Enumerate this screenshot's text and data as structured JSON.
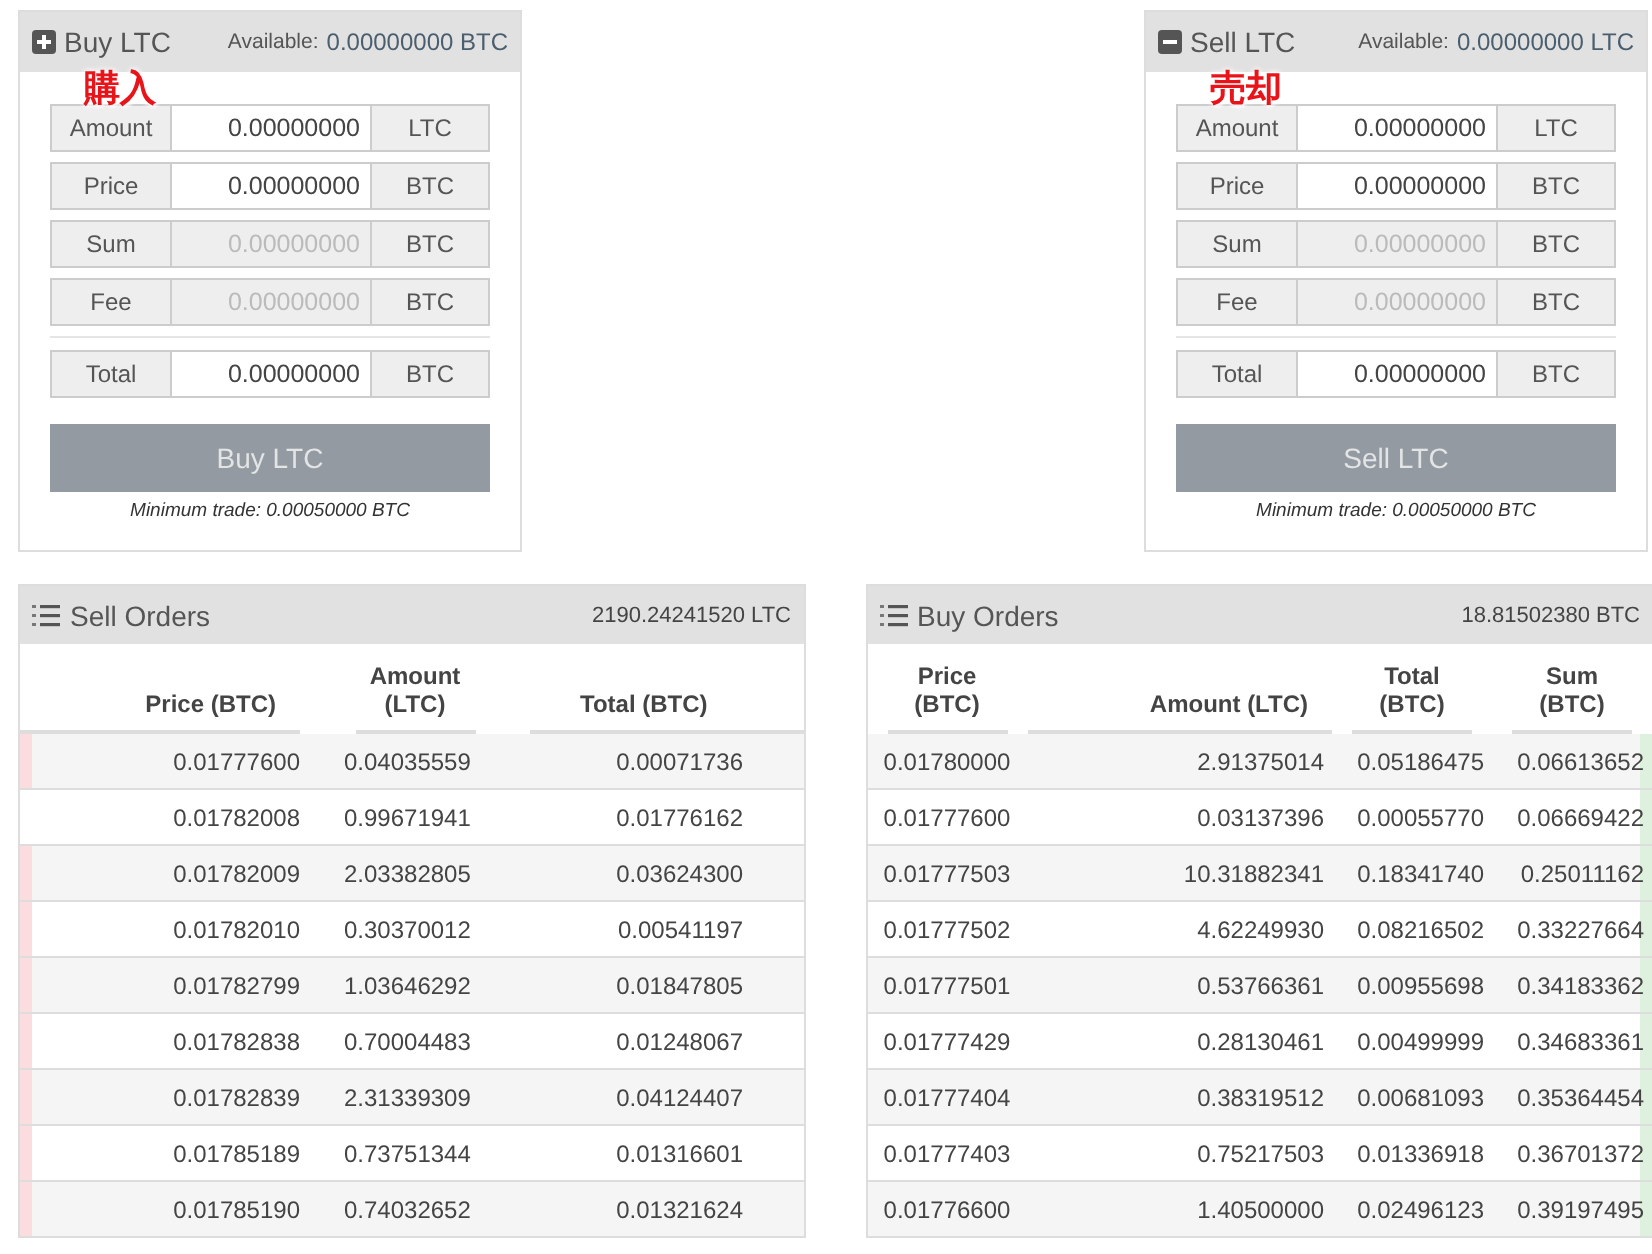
{
  "trade_panels": [
    {
      "kind": "buy",
      "title": "Buy LTC",
      "available_label": "Available:",
      "available_value": "0.00000000 BTC",
      "annotation": "購入",
      "fields": [
        {
          "label": "Amount",
          "value": "0.00000000",
          "unit": "LTC",
          "disabled": false
        },
        {
          "label": "Price",
          "value": "0.00000000",
          "unit": "BTC",
          "disabled": false
        },
        {
          "label": "Sum",
          "value": "0.00000000",
          "unit": "BTC",
          "disabled": true
        },
        {
          "label": "Fee",
          "value": "0.00000000",
          "unit": "BTC",
          "disabled": true
        }
      ],
      "total": {
        "label": "Total",
        "value": "0.00000000",
        "unit": "BTC",
        "disabled": false
      },
      "button": "Buy LTC",
      "minimum": "Minimum trade: 0.00050000 BTC"
    },
    {
      "kind": "sell",
      "title": "Sell LTC",
      "available_label": "Available:",
      "available_value": "0.00000000 LTC",
      "annotation": "売却",
      "fields": [
        {
          "label": "Amount",
          "value": "0.00000000",
          "unit": "LTC",
          "disabled": false
        },
        {
          "label": "Price",
          "value": "0.00000000",
          "unit": "BTC",
          "disabled": false
        },
        {
          "label": "Sum",
          "value": "0.00000000",
          "unit": "BTC",
          "disabled": true
        },
        {
          "label": "Fee",
          "value": "0.00000000",
          "unit": "BTC",
          "disabled": true
        }
      ],
      "total": {
        "label": "Total",
        "value": "0.00000000",
        "unit": "BTC",
        "disabled": false
      },
      "button": "Sell LTC",
      "minimum": "Minimum trade: 0.00050000 BTC"
    }
  ],
  "order_books": [
    {
      "kind": "sell",
      "title": "Sell Orders",
      "summary": "2190.24241520 LTC",
      "columns": [
        "Price (BTC)",
        "Amount (LTC)",
        "Total (BTC)"
      ],
      "rows": [
        {
          "cells": [
            "0.01777600",
            "0.04035559",
            "0.00071736"
          ],
          "marked": true
        },
        {
          "cells": [
            "0.01782008",
            "0.99671941",
            "0.01776162"
          ],
          "marked": false
        },
        {
          "cells": [
            "0.01782009",
            "2.03382805",
            "0.03624300"
          ],
          "marked": true
        },
        {
          "cells": [
            "0.01782010",
            "0.30370012",
            "0.00541197"
          ],
          "marked": true
        },
        {
          "cells": [
            "0.01782799",
            "1.03646292",
            "0.01847805"
          ],
          "marked": true
        },
        {
          "cells": [
            "0.01782838",
            "0.70004483",
            "0.01248067"
          ],
          "marked": true
        },
        {
          "cells": [
            "0.01782839",
            "2.31339309",
            "0.04124407"
          ],
          "marked": true
        },
        {
          "cells": [
            "0.01785189",
            "0.73751344",
            "0.01316601"
          ],
          "marked": true
        },
        {
          "cells": [
            "0.01785190",
            "0.74032652",
            "0.01321624"
          ],
          "marked": true
        }
      ]
    },
    {
      "kind": "buy",
      "title": "Buy Orders",
      "summary": "18.81502380 BTC",
      "columns": [
        "Price (BTC)",
        "Amount (LTC)",
        "Total (BTC)",
        "Sum (BTC)"
      ],
      "rows": [
        {
          "cells": [
            "0.01780000",
            "2.91375014",
            "0.05186475",
            "0.06613652"
          ],
          "marked": true
        },
        {
          "cells": [
            "0.01777600",
            "0.03137396",
            "0.00055770",
            "0.06669422"
          ],
          "marked": true
        },
        {
          "cells": [
            "0.01777503",
            "10.31882341",
            "0.18341740",
            "0.25011162"
          ],
          "marked": true
        },
        {
          "cells": [
            "0.01777502",
            "4.62249930",
            "0.08216502",
            "0.33227664"
          ],
          "marked": true
        },
        {
          "cells": [
            "0.01777501",
            "0.53766361",
            "0.00955698",
            "0.34183362"
          ],
          "marked": true
        },
        {
          "cells": [
            "0.01777429",
            "0.28130461",
            "0.00499999",
            "0.34683361"
          ],
          "marked": true
        },
        {
          "cells": [
            "0.01777404",
            "0.38319512",
            "0.00681093",
            "0.35364454"
          ],
          "marked": true
        },
        {
          "cells": [
            "0.01777403",
            "0.75217503",
            "0.01336918",
            "0.36701372"
          ],
          "marked": true
        },
        {
          "cells": [
            "0.01776600",
            "1.40500000",
            "0.02496123",
            "0.39197495"
          ],
          "marked": true
        }
      ]
    }
  ]
}
